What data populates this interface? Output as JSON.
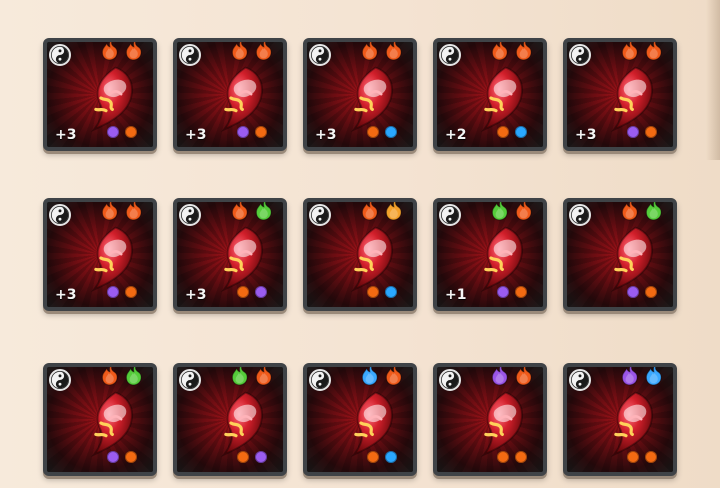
{
  "colors": {
    "fire": "#f05a1a",
    "wind": "#55cc3a",
    "ice": "#3aa8ff",
    "arcane": "#9a55e6",
    "lightning": "#f4a12a",
    "dot_orange": "#f36a12",
    "dot_purple": "#9b5cf0",
    "dot_blue": "#2aa7ff"
  },
  "cards": [
    {
      "level": "+3",
      "elements": [
        "fire",
        "fire"
      ],
      "dots": [
        "dot_purple",
        "dot_orange"
      ]
    },
    {
      "level": "+3",
      "elements": [
        "fire",
        "fire"
      ],
      "dots": [
        "dot_purple",
        "dot_orange"
      ]
    },
    {
      "level": "+3",
      "elements": [
        "fire",
        "fire"
      ],
      "dots": [
        "dot_orange",
        "dot_blue"
      ]
    },
    {
      "level": "+2",
      "elements": [
        "fire",
        "fire"
      ],
      "dots": [
        "dot_orange",
        "dot_blue"
      ]
    },
    {
      "level": "+3",
      "elements": [
        "fire",
        "fire"
      ],
      "dots": [
        "dot_purple",
        "dot_orange"
      ]
    },
    {
      "level": "+3",
      "elements": [
        "fire",
        "fire"
      ],
      "dots": [
        "dot_purple",
        "dot_orange"
      ]
    },
    {
      "level": "+3",
      "elements": [
        "fire",
        "wind"
      ],
      "dots": [
        "dot_orange",
        "dot_purple"
      ]
    },
    {
      "level": "",
      "elements": [
        "fire",
        "lightning"
      ],
      "dots": [
        "dot_orange",
        "dot_blue"
      ]
    },
    {
      "level": "+1",
      "elements": [
        "wind",
        "fire"
      ],
      "dots": [
        "dot_purple",
        "dot_orange"
      ]
    },
    {
      "level": "",
      "elements": [
        "fire",
        "wind"
      ],
      "dots": [
        "dot_purple",
        "dot_orange"
      ]
    },
    {
      "level": "",
      "elements": [
        "fire",
        "wind"
      ],
      "dots": [
        "dot_purple",
        "dot_orange"
      ]
    },
    {
      "level": "",
      "elements": [
        "wind",
        "fire"
      ],
      "dots": [
        "dot_orange",
        "dot_purple"
      ]
    },
    {
      "level": "",
      "elements": [
        "ice",
        "fire"
      ],
      "dots": [
        "dot_orange",
        "dot_blue"
      ]
    },
    {
      "level": "",
      "elements": [
        "arcane",
        "fire"
      ],
      "dots": [
        "dot_orange",
        "dot_orange"
      ]
    },
    {
      "level": "",
      "elements": [
        "arcane",
        "ice"
      ],
      "dots": [
        "dot_orange",
        "dot_orange"
      ]
    }
  ]
}
